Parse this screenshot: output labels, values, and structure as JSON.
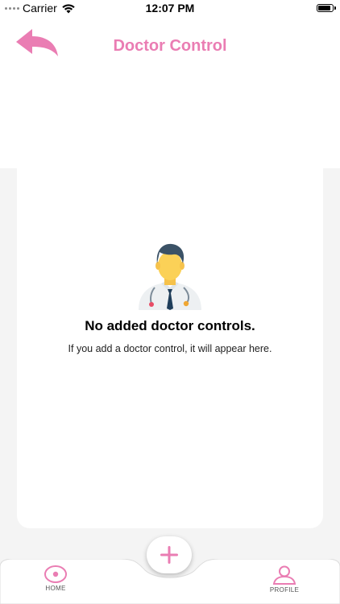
{
  "status_bar": {
    "carrier": "Carrier",
    "time": "12:07 PM",
    "icons": [
      "signal-dots-icon",
      "wifi-icon",
      "battery-icon"
    ]
  },
  "header": {
    "title": "Doctor Control",
    "back_icon": "back-arrow-icon"
  },
  "empty_state": {
    "illustration": "doctor-icon",
    "title": "No added doctor controls.",
    "subtitle": "If you add a doctor control, it will appear here."
  },
  "tab_bar": {
    "home_label": "HOME",
    "home_icon": "eye-icon",
    "profile_label": "PROFILE",
    "profile_icon": "user-icon",
    "add_icon": "plus-icon"
  },
  "colors": {
    "accent": "#ea7db3",
    "background": "#f4f4f4",
    "card": "#ffffff"
  }
}
